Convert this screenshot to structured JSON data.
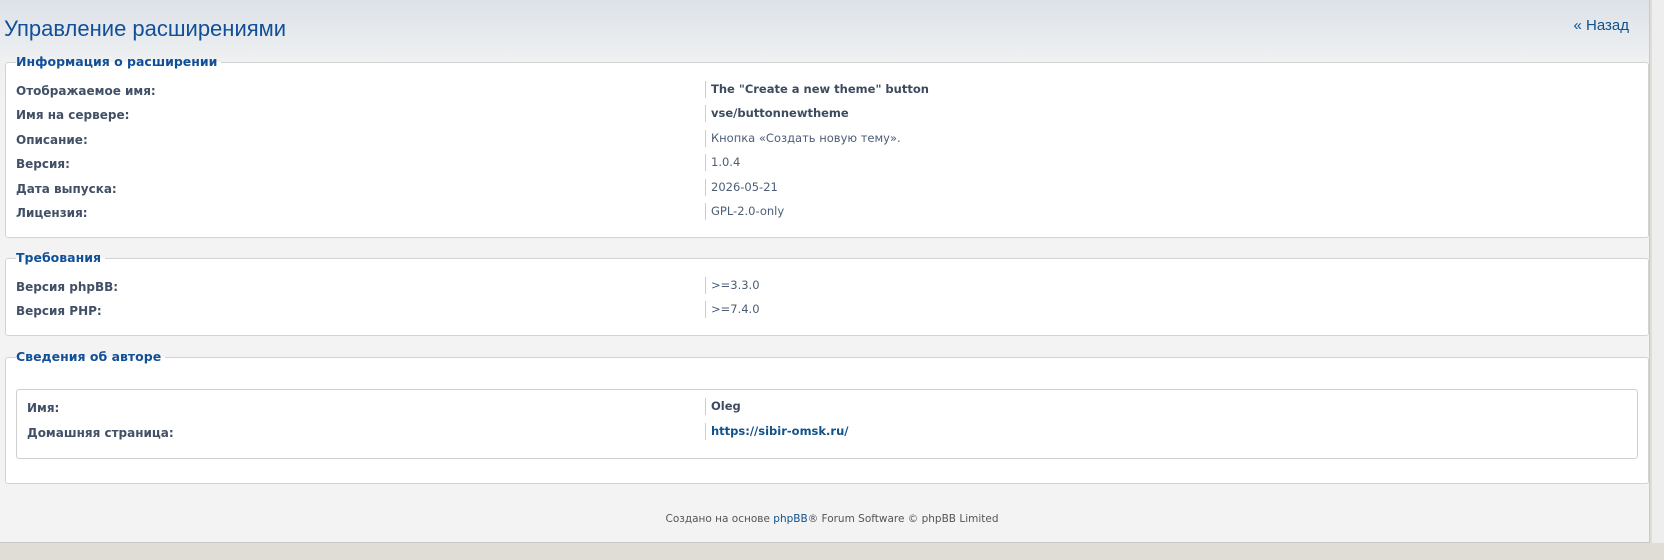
{
  "header": {
    "title": "Управление расширениями",
    "back_label": "« Назад"
  },
  "extension_info": {
    "legend": "Информация о расширении",
    "rows": [
      {
        "label": "Отображаемое имя:",
        "value": "The \"Create a new theme\" button"
      },
      {
        "label": "Имя на сервере:",
        "value": "vse/buttonnewtheme"
      },
      {
        "label": "Описание:",
        "value": "Кнопка «Создать новую тему»."
      },
      {
        "label": "Версия:",
        "value": "1.0.4"
      },
      {
        "label": "Дата выпуска:",
        "value": "2026-05-21"
      },
      {
        "label": "Лицензия:",
        "value": "GPL-2.0-only"
      }
    ]
  },
  "requirements": {
    "legend": "Требования",
    "rows": [
      {
        "label": "Версия phpBB:",
        "value": ">=3.3.0"
      },
      {
        "label": "Версия PHP:",
        "value": ">=7.4.0"
      }
    ]
  },
  "author": {
    "legend": "Сведения об авторе",
    "rows": [
      {
        "label": "Имя:",
        "value": "Oleg"
      },
      {
        "label": "Домашняя страница:",
        "value": "https://sibir-omsk.ru/"
      }
    ]
  },
  "footer": {
    "prefix": "Создано на основе",
    "link": "phpBB",
    "suffix": "® Forum Software © phpBB Limited"
  },
  "colors": {
    "title": "#115098",
    "link": "#105289",
    "label": "#425067"
  }
}
